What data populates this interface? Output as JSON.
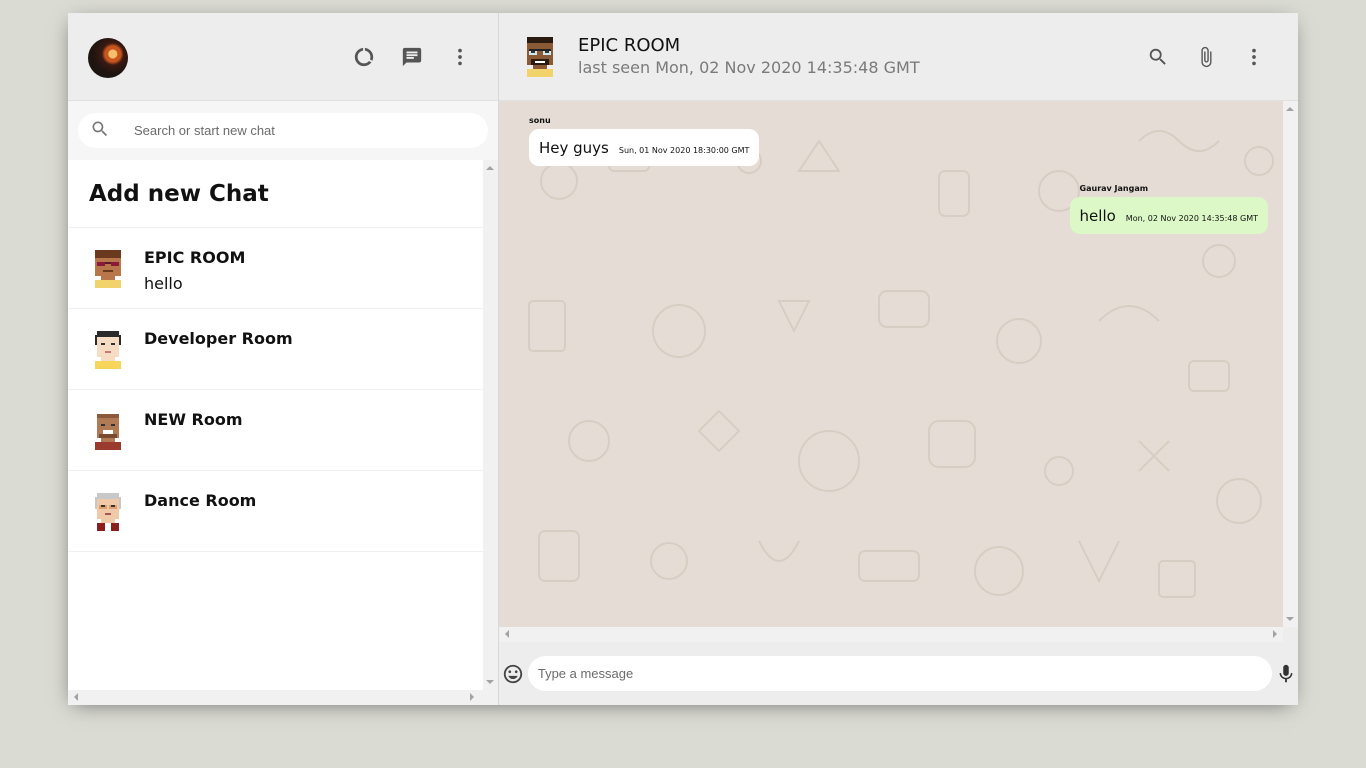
{
  "sidebar": {
    "search": {
      "placeholder": "Search or start new chat"
    },
    "add_chat_label": "Add new Chat",
    "rooms": [
      {
        "name": "EPIC ROOM",
        "last_message": "hello"
      },
      {
        "name": "Developer Room",
        "last_message": ""
      },
      {
        "name": "NEW Room",
        "last_message": ""
      },
      {
        "name": "Dance Room",
        "last_message": ""
      }
    ]
  },
  "chat": {
    "room_name": "EPIC ROOM",
    "last_seen": "last seen Mon, 02 Nov 2020 14:35:48 GMT",
    "messages": [
      {
        "sender": "sonu",
        "text": "Hey guys",
        "timestamp": "Sun, 01 Nov 2020 18:30:00 GMT",
        "mine": false
      },
      {
        "sender": "Gaurav Jangam",
        "text": "hello",
        "timestamp": "Mon, 02 Nov 2020 14:35:48 GMT",
        "mine": true
      }
    ],
    "input": {
      "placeholder": "Type a message"
    }
  },
  "icons": {
    "status": "data-usage-icon",
    "new_chat": "chat-icon",
    "menu": "more-vert-icon",
    "search": "search-icon",
    "attach": "attach-file-icon",
    "emoji": "emoji-icon",
    "mic": "mic-icon"
  },
  "colors": {
    "page_background": "#dadbd3",
    "header_background": "#ededed",
    "chat_background": "#e5ddd5",
    "own_bubble": "#dcf8c6",
    "other_bubble": "#ffffff"
  }
}
